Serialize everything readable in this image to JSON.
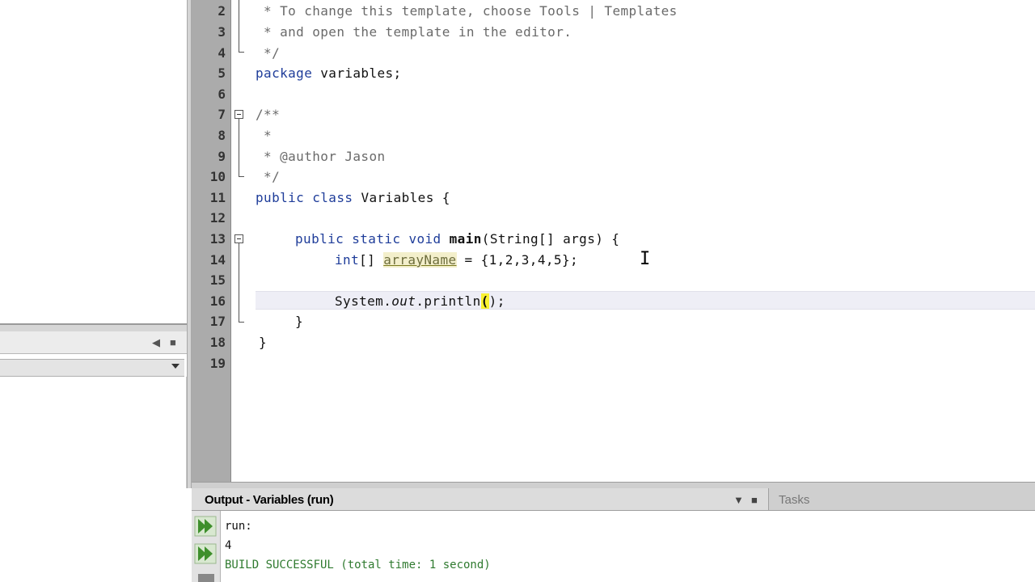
{
  "editor": {
    "line_numbers": [
      "2",
      "3",
      "4",
      "5",
      "6",
      "7",
      "8",
      "9",
      "10",
      "11",
      "12",
      "13",
      "14",
      "15",
      "16",
      "17",
      "18",
      "19"
    ],
    "lines": {
      "l2": " * To change this template, choose Tools | Templates",
      "l3": " * and open the template in the editor.",
      "l4": " */",
      "l5_kw": "package",
      "l5_rest": " variables;",
      "l7": "/**",
      "l8": " *",
      "l9": " * @author Jason",
      "l10": " */",
      "l11_kw": "public class",
      "l11_rest": " Variables {",
      "l13_kw": "public static void",
      "l13_method": "main",
      "l13_rest": "(String[] args) {",
      "l14_kw": "int",
      "l14_brackets": "[] ",
      "l14_var": "arrayName",
      "l14_rest": " = {1,2,3,4,5};",
      "l16_class": "System.",
      "l16_field": "out",
      "l16_call": ".println",
      "l16_paren_open": "(",
      "l16_paren_close": ")",
      "l16_end": ";",
      "l17": "}",
      "l18": "}"
    }
  },
  "output": {
    "title": "Output - Variables (run)",
    "lines": [
      "run:",
      "4",
      "BUILD SUCCESSFUL (total time: 1 second)"
    ]
  },
  "tasks": {
    "label": "Tasks"
  },
  "icons": {
    "rerun": "rerun-icon",
    "rerun_with_input": "rerun-with-input-icon",
    "minimize": "minimize-icon",
    "close": "close-icon",
    "dropdown": "dropdown-arrow-icon"
  },
  "colors": {
    "keyword": "#1f3d9a",
    "comment": "#6a6a6a",
    "gutter": "#ababab",
    "build_success": "#2f7a2f",
    "caret_highlight": "#f9f130"
  }
}
